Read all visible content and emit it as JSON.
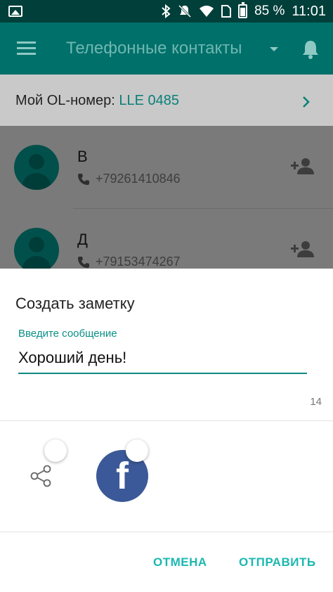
{
  "status_bar": {
    "battery": "85 %",
    "time": "11:01",
    "icons": [
      "gallery-icon",
      "bluetooth-icon",
      "mute-icon",
      "wifi-icon",
      "no-sim-icon",
      "battery-icon"
    ]
  },
  "app_bar": {
    "title": "Телефонные контакты",
    "icons": [
      "menu-icon",
      "dropdown-caret-icon",
      "bell-icon"
    ]
  },
  "my_number": {
    "label": "Мой OL-номер: ",
    "value": "LLE 0485"
  },
  "contacts": [
    {
      "name": "В",
      "phone": "+79261410846"
    },
    {
      "name": "Д",
      "phone": "+79153474267"
    }
  ],
  "dialog": {
    "title": "Создать заметку",
    "field_label": "Введите сообщение",
    "field_value": "Хороший день!",
    "char_count": "14",
    "share_targets": [
      "share-icon",
      "facebook-icon"
    ],
    "facebook_letter": "f",
    "cancel_label": "ОТМЕНА",
    "send_label": "ОТПРАВИТЬ"
  },
  "colors": {
    "app_bar": "#00706a",
    "accent": "#1bb8b0",
    "facebook": "#3b5998"
  }
}
